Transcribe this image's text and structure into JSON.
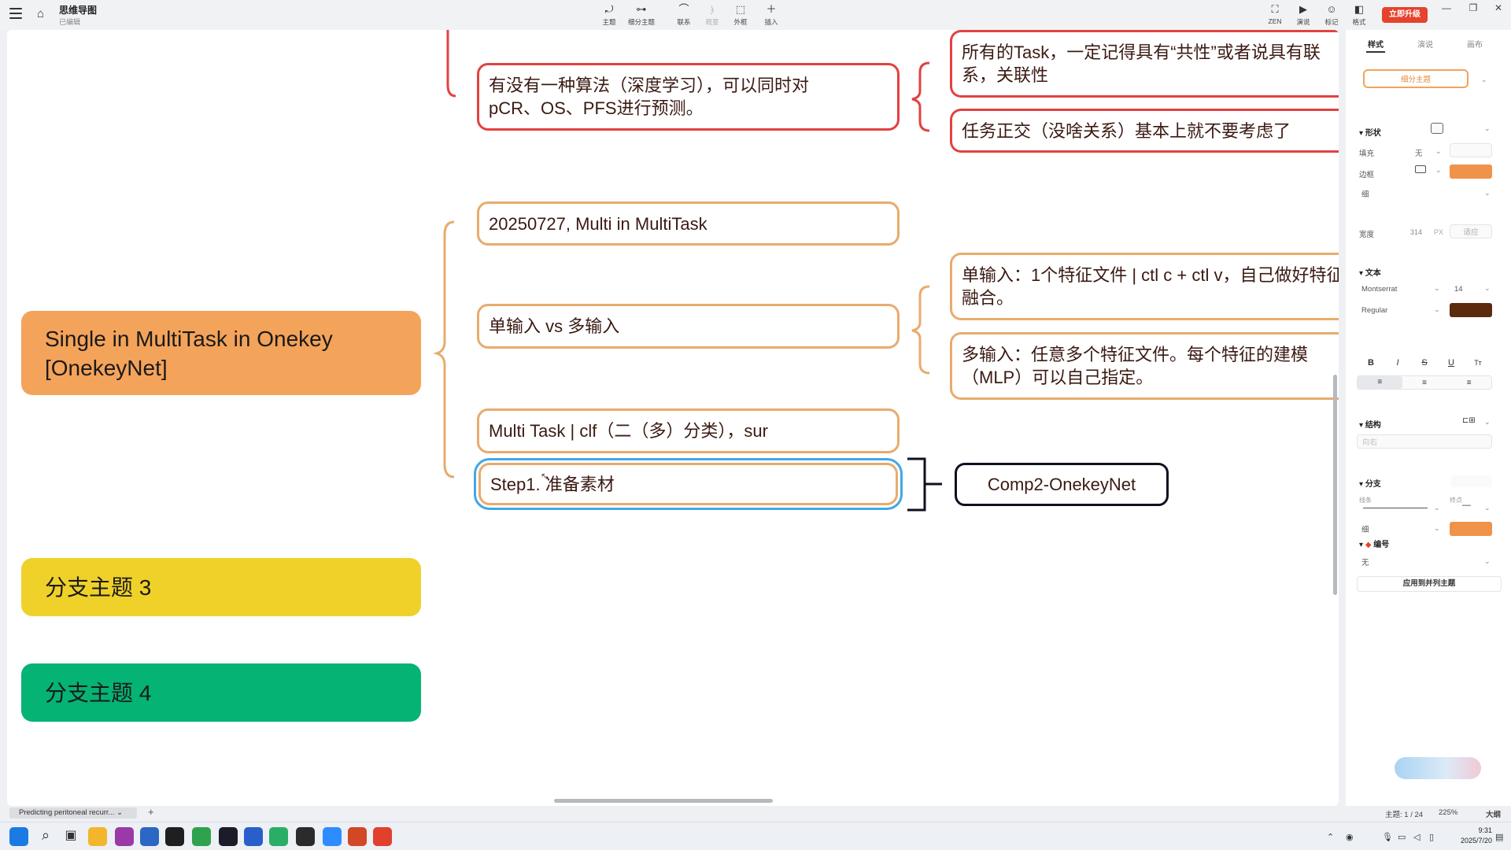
{
  "app": {
    "title": "思维导图",
    "status": "已编辑",
    "home_icon": "⌂"
  },
  "toolbar": [
    {
      "label": "主题",
      "icon": "⤾",
      "name": "topic-tool",
      "enabled": true
    },
    {
      "label": "细分主题",
      "icon": "⊶",
      "name": "subtopic-tool",
      "enabled": true
    },
    {
      "label": "联系",
      "icon": "⌒",
      "name": "relation-tool",
      "enabled": true
    },
    {
      "label": "概要",
      "icon": "⦒",
      "name": "summary-tool",
      "enabled": false
    },
    {
      "label": "外框",
      "icon": "⬚",
      "name": "boundary-tool",
      "enabled": true
    },
    {
      "label": "插入",
      "icon": "＋",
      "name": "insert-tool",
      "enabled": true
    }
  ],
  "toolbar_right": [
    {
      "label": "ZEN",
      "icon": "⛶",
      "name": "zen-tool"
    },
    {
      "label": "演说",
      "icon": "▶",
      "name": "present-tool"
    },
    {
      "label": "标记",
      "icon": "☺",
      "name": "marker-tool"
    },
    {
      "label": "格式",
      "icon": "◧",
      "name": "format-tool"
    }
  ],
  "upgrade_label": "立即升级",
  "canvas": {
    "central": {
      "text": "Single in MultiTask in Onekey [OnekeyNet]",
      "color": "#f4a35a"
    },
    "branches": [
      {
        "text": "分支主题 3",
        "color": "#f0d12a"
      },
      {
        "text": "分支主题 4",
        "color": "#05b374"
      }
    ],
    "subtopics": [
      {
        "text": "有没有一种算法（深度学习），可以同时对pCR、OS、PFS进行预测。",
        "border": "#e34141"
      },
      {
        "text": "20250727, Multi in MultiTask",
        "border": "#e8ab6d"
      },
      {
        "text": "单输入 vs 多输入",
        "border": "#e8ab6d"
      },
      {
        "text": "Multi Task | clf（二（多）分类），sur",
        "border": "#e8ab6d"
      },
      {
        "text": "Step1. 准备素材",
        "border": "#e8ab6d",
        "selected": true
      }
    ],
    "children": [
      {
        "text": "所有的Task，一定记得具有“共性”或者说具有联系，关联性",
        "border": "#e34141"
      },
      {
        "text": "任务正交（没啥关系）基本上就不要考虑了",
        "border": "#e34141"
      },
      {
        "text": "单输入：1个特征文件 | ctl c + ctl v，自己做好特征融合。",
        "border": "#e8ab6d"
      },
      {
        "text": "多输入：任意多个特征文件。每个特征的建模（MLP）可以自己指定。",
        "border": "#e8ab6d"
      },
      {
        "text": "Comp2-OnekeyNet",
        "border": "#0f1020"
      }
    ]
  },
  "panel": {
    "tabs": [
      "样式",
      "演说",
      "画布"
    ],
    "style_preset": "细分主题",
    "shape": {
      "section": "形状",
      "fill_label": "填充",
      "fill_value": "无",
      "border_label": "边框",
      "border_color": "#f0934a",
      "border_weight": "细"
    },
    "width": {
      "label": "宽度",
      "value": "314",
      "unit": "PX",
      "fit": "适应"
    },
    "text": {
      "section": "文本",
      "font": "Montserrat",
      "size": "14",
      "weight": "Regular",
      "color": "#5c2a0d",
      "buttons": [
        "B",
        "I",
        "S",
        "U",
        "Tт"
      ]
    },
    "structure": {
      "section": "结构",
      "value": "向右"
    },
    "branch": {
      "section": "分支",
      "line_label": "线条",
      "end_label": "终点",
      "weight": "细",
      "color": "#f0934a"
    },
    "numbering": {
      "section": "编号",
      "value": "无"
    },
    "apply_label": "应用到并列主题"
  },
  "statusbar": {
    "doc_tab": "Predicting peritoneal recurr...",
    "topic_count": "主题: 1 / 24",
    "zoom": "225%",
    "outline": "大纲"
  },
  "taskbar": {
    "time": "9:31",
    "date": "2025/7/20",
    "apps": [
      {
        "name": "windows-start-icon",
        "color": "#1c7ae3"
      },
      {
        "name": "search-icon",
        "color": "#333333"
      },
      {
        "name": "task-view-icon",
        "color": "#333333"
      },
      {
        "name": "file-explorer-icon",
        "color": "#f3b52c"
      },
      {
        "name": "cursor-app-icon",
        "color": "#9a3aa6"
      },
      {
        "name": "feather-app-icon",
        "color": "#2b67c3"
      },
      {
        "name": "pycharm-icon",
        "color": "#1f1f1f"
      },
      {
        "name": "chrome-icon",
        "color": "#2fa24d"
      },
      {
        "name": "terminal-app-icon",
        "color": "#1b1b2a"
      },
      {
        "name": "vscode-icon",
        "color": "#2a5fcb"
      },
      {
        "name": "wechat-icon",
        "color": "#2aae67"
      },
      {
        "name": "cmd-icon",
        "color": "#2b2b2b"
      },
      {
        "name": "zoom-meeting-icon",
        "color": "#2d8cff"
      },
      {
        "name": "powerpoint-icon",
        "color": "#d24726"
      },
      {
        "name": "xmind-icon",
        "color": "#e0412c"
      }
    ]
  }
}
